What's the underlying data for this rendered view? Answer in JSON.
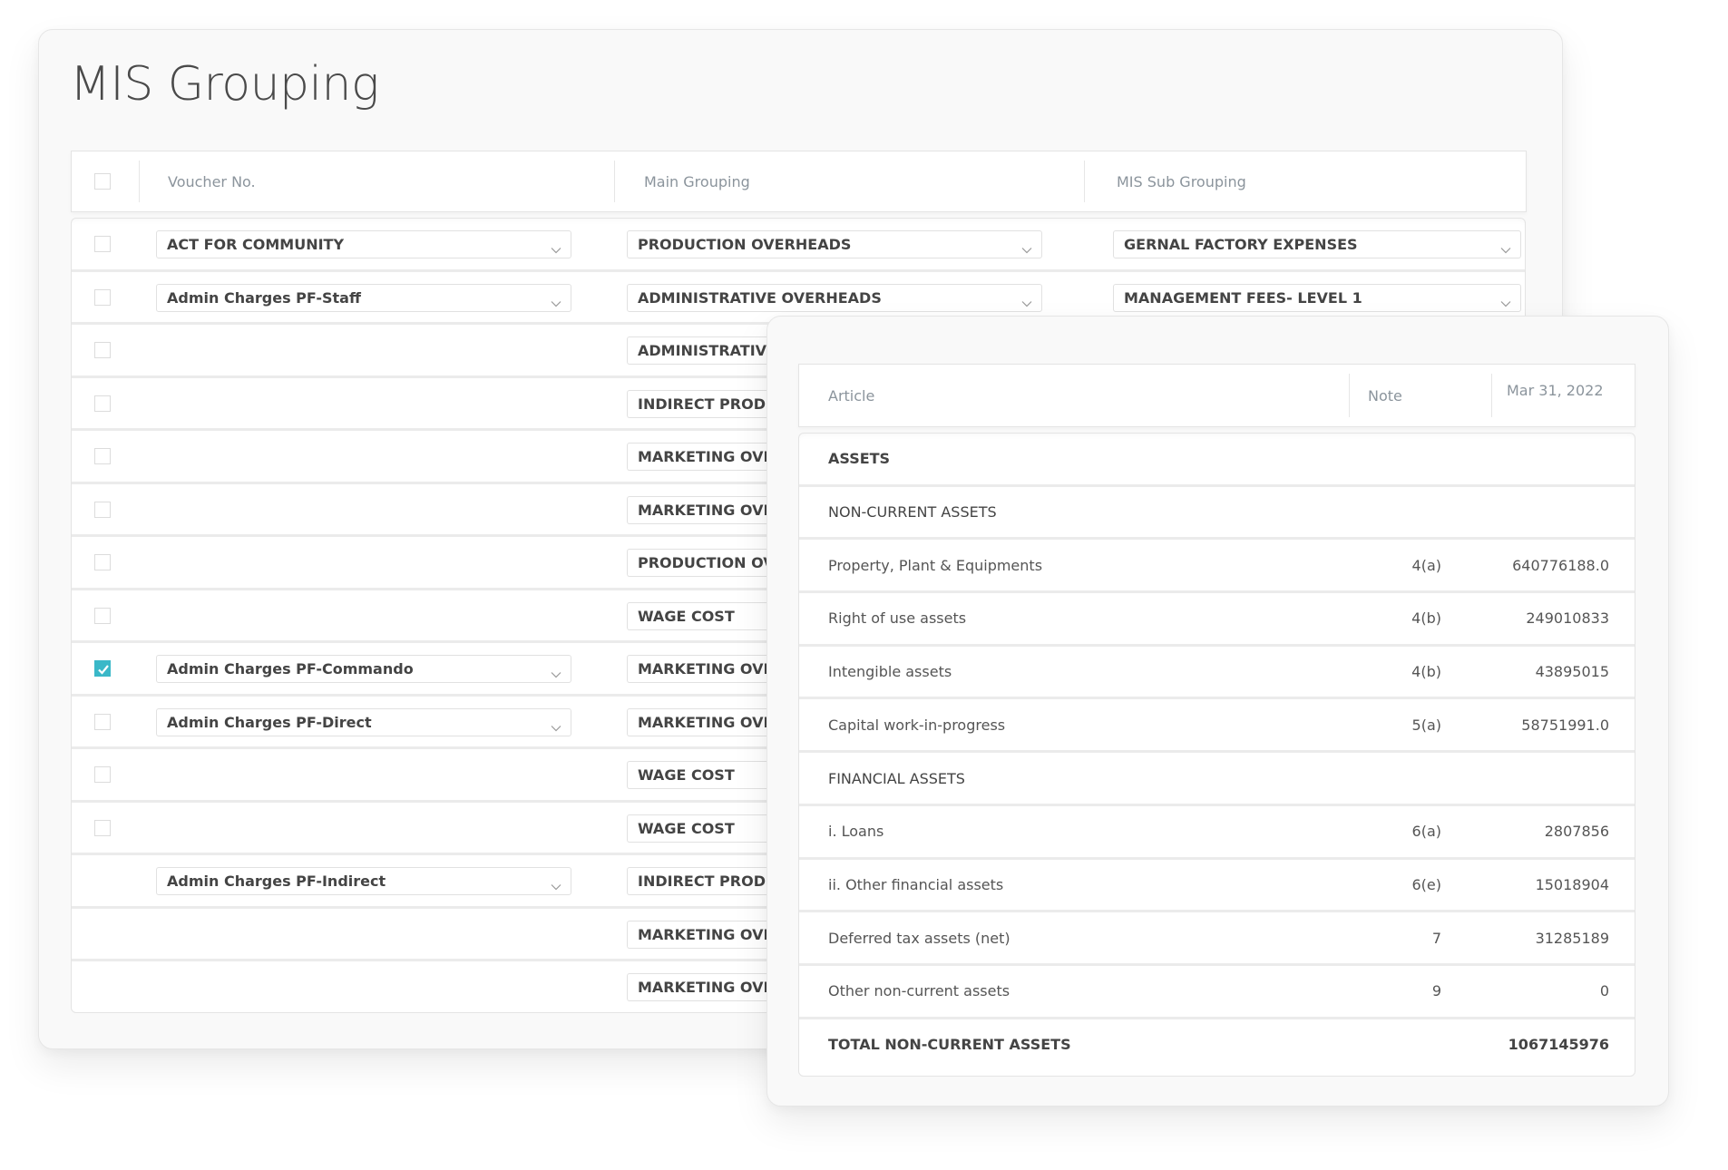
{
  "page": {
    "title": "MIS Grouping"
  },
  "grouping_table": {
    "headers": {
      "voucher": "Voucher No.",
      "main": "Main Grouping",
      "sub": "MIS Sub Grouping"
    },
    "rows": [
      {
        "checkbox": true,
        "checked": false,
        "voucher": "ACT FOR COMMUNITY",
        "main": "PRODUCTION OVERHEADS",
        "sub": "GERNAL FACTORY EXPENSES"
      },
      {
        "checkbox": true,
        "checked": false,
        "voucher": "Admin Charges PF-Staff",
        "main": "ADMINISTRATIVE OVERHEADS",
        "sub": "MANAGEMENT FEES- LEVEL 1"
      },
      {
        "checkbox": true,
        "checked": false,
        "voucher": "",
        "main": "ADMINISTRATIVE OVERHEADS",
        "sub": ""
      },
      {
        "checkbox": true,
        "checked": false,
        "voucher": "",
        "main": "INDIRECT PRODUCTION",
        "sub": ""
      },
      {
        "checkbox": true,
        "checked": false,
        "voucher": "",
        "main": "MARKETING OVERHEADS",
        "sub": ""
      },
      {
        "checkbox": true,
        "checked": false,
        "voucher": "",
        "main": "MARKETING OVERHEADS",
        "sub": ""
      },
      {
        "checkbox": true,
        "checked": false,
        "voucher": "",
        "main": "PRODUCTION OVERHEADS",
        "sub": ""
      },
      {
        "checkbox": true,
        "checked": false,
        "voucher": "",
        "main": "WAGE COST",
        "sub": ""
      },
      {
        "checkbox": true,
        "checked": true,
        "voucher": "Admin Charges PF-Commando",
        "main": "MARKETING OVERHEADS",
        "sub": ""
      },
      {
        "checkbox": true,
        "checked": false,
        "voucher": "Admin Charges PF-Direct",
        "main": "MARKETING OVERHEADS",
        "sub": ""
      },
      {
        "checkbox": true,
        "checked": false,
        "voucher": "",
        "main": "WAGE COST",
        "sub": ""
      },
      {
        "checkbox": true,
        "checked": false,
        "voucher": "",
        "main": "WAGE COST",
        "sub": ""
      },
      {
        "checkbox": false,
        "checked": false,
        "voucher": "Admin Charges PF-Indirect",
        "main": "INDIRECT PRODUCTION",
        "sub": ""
      },
      {
        "checkbox": false,
        "checked": false,
        "voucher": "",
        "main": "MARKETING OVERHEADS",
        "sub": ""
      },
      {
        "checkbox": false,
        "checked": false,
        "voucher": "",
        "main": "MARKETING OVERHEADS",
        "sub": ""
      }
    ]
  },
  "balance_sheet": {
    "headers": {
      "article": "Article",
      "note": "Note",
      "date": "Mar 31, 2022"
    },
    "rows": [
      {
        "type": "section-strong",
        "article": "ASSETS",
        "note": "",
        "amount": ""
      },
      {
        "type": "section",
        "article": "NON-CURRENT ASSETS",
        "note": "",
        "amount": ""
      },
      {
        "type": "item",
        "article": "Property, Plant & Equipments",
        "note": "4(a)",
        "amount": "640776188.0"
      },
      {
        "type": "item",
        "article": "Right of use assets",
        "note": "4(b)",
        "amount": "249010833"
      },
      {
        "type": "item",
        "article": "Intengible assets",
        "note": "4(b)",
        "amount": "43895015"
      },
      {
        "type": "item",
        "article": "Capital work-in-progress",
        "note": "5(a)",
        "amount": "58751991.0"
      },
      {
        "type": "section",
        "article": "FINANCIAL ASSETS",
        "note": "",
        "amount": ""
      },
      {
        "type": "item",
        "article": "i. Loans",
        "note": "6(a)",
        "amount": "2807856"
      },
      {
        "type": "item",
        "article": "ii. Other financial assets",
        "note": "6(e)",
        "amount": "15018904"
      },
      {
        "type": "item",
        "article": "Deferred tax assets (net)",
        "note": "7",
        "amount": "31285189"
      },
      {
        "type": "item",
        "article": "Other non-current assets",
        "note": "9",
        "amount": "0"
      },
      {
        "type": "total",
        "article": "TOTAL NON-CURRENT ASSETS",
        "note": "",
        "amount": "1067145976"
      }
    ]
  },
  "colors": {
    "accent_checkbox": "#3ab8c8"
  }
}
